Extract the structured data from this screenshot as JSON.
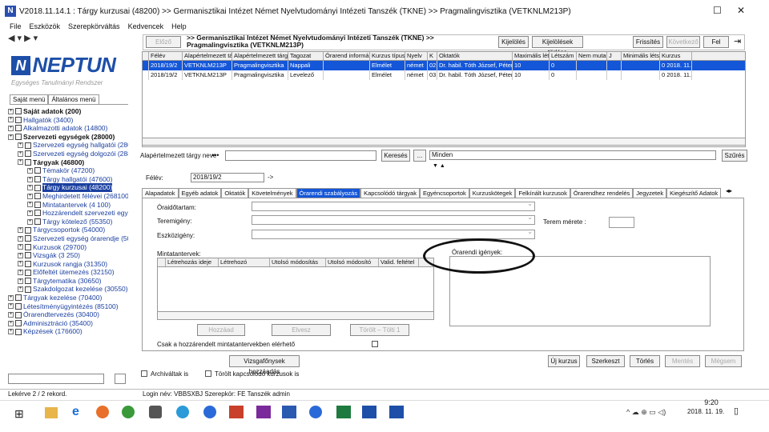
{
  "window": {
    "title": "V2018.11.14.1 : Tárgy kurzusai (48200) >> Germanisztikai Intézet Német Nyelvtudományi Intézeti Tanszék (TKNE) >> Pragmalingvisztika (VETKNLM213P)",
    "app_icon": "N"
  },
  "menu": [
    "File",
    "Eszközök",
    "Szerepkörváltás",
    "Kedvencek",
    "Help"
  ],
  "logo": {
    "brand": "NEPTUN",
    "subtitle": "Egységes Tanulmányi Rendszer"
  },
  "left_tabs": [
    "Saját menü",
    "Általános menü"
  ],
  "tree": [
    {
      "label": "Saját adatok (200)",
      "bold": true
    },
    {
      "label": "Hallgatók (3400)",
      "blue": true
    },
    {
      "label": "Alkalmazotti adatok (14800)",
      "blue": true
    },
    {
      "label": "Szervezeti egységek (28000)",
      "bold": true
    },
    {
      "label": "Szervezeti egység hallgatói (2800",
      "blue": true
    },
    {
      "label": "Szervezeti egység dolgozói (2880",
      "blue": true
    },
    {
      "label": "Tárgyak (46800)",
      "bold": true
    },
    {
      "label": "Témakör (47200)",
      "blue": true
    },
    {
      "label": "Tárgy hallgatói (47600)",
      "blue": true
    },
    {
      "label": "Tárgy kurzusai (48200)",
      "sel": true
    },
    {
      "label": "Meghirdetett félévei (268100)",
      "blue": true
    },
    {
      "label": "Mintatantervek (4 100)",
      "blue": true
    },
    {
      "label": "Hozzárendelt szervezeti egys",
      "blue": true
    },
    {
      "label": "Tárgy kötelező (55350)",
      "blue": true
    },
    {
      "label": "Tárgycsoportok (54000)",
      "blue": true
    },
    {
      "label": "Szervezeti egység órarendje (500",
      "blue": true
    },
    {
      "label": "Kurzusok (29700)",
      "blue": true
    },
    {
      "label": "Vizsgák (3 250)",
      "blue": true
    },
    {
      "label": "Kurzusok rangja (31350)",
      "blue": true
    },
    {
      "label": "Előfeltét ütemezés (32150)",
      "blue": true
    },
    {
      "label": "Tárgytematika (30650)",
      "blue": true
    },
    {
      "label": "Szakdolgozat kezelése (30550)",
      "blue": true
    },
    {
      "label": "Tárgyak kezelése (70400)",
      "blue": true
    },
    {
      "label": "Létesítményügyintézés (85100)",
      "blue": true
    },
    {
      "label": "Órarendtervezés (30400)",
      "blue": true
    },
    {
      "label": "Adminisztráció (35400)",
      "blue": true
    },
    {
      "label": "Képzések (176600)",
      "blue": true
    }
  ],
  "top": {
    "prev_button": "Előző",
    "breadcrumb": ">> Germanisztikai Intézet Német Nyelvtudományi Intézeti Tanszék (TKNE) >> Pragmalingvisztika (VETKNLM213P)",
    "buttons": [
      "Kijelölés",
      "Kijelölések törlése"
    ],
    "right_buttons": [
      "Frissítés",
      "Következő",
      "Fel"
    ]
  },
  "grid": {
    "columns": [
      "Félév",
      "Alapértelmezett tárgy",
      "Alapértelmezett tárgy neve",
      "Tagozat",
      "Órarend információ",
      "Kurzus típus",
      "Nyelv",
      "K",
      "Oktatók",
      "Maximális létszám",
      "Létszám",
      "Nem mutat",
      "J",
      "Minimális létszám",
      "Kurzus"
    ],
    "rows": [
      [
        "2018/19/2",
        "VETKNLM213P",
        "Pragmalingvisztika",
        "Nappali",
        "",
        "Elmélet",
        "német",
        "02",
        "Dr. habil. Tóth József, Péter",
        "10",
        "0",
        "",
        "",
        "",
        "0 2018. 11."
      ],
      [
        "2018/19/2",
        "VETKNLM213P",
        "Pragmalingvisztika",
        "Levelező",
        "",
        "Elmélet",
        "német",
        "03",
        "Dr. habil. Tóth József, Péter",
        "10",
        "0",
        "",
        "",
        "",
        "0 2018. 11."
      ]
    ]
  },
  "filter": {
    "label": "Alapértelmezett tárgy neve",
    "ops": "•••",
    "search_button": "Keresés",
    "dots_button": "...",
    "dropdown": "Minden",
    "apply_button": "Szűrés"
  },
  "semester": {
    "label": "Félév:",
    "value": "2018/19/2",
    "arrow": "->"
  },
  "tabs": [
    "Alapadatok",
    "Egyéb adatok",
    "Oktatók",
    "Követelmények",
    "Órarendi szabályozás",
    "Kapcsolódó tárgyak",
    "Egyéncsoportok",
    "Kurzuskötegek",
    "Felkínált kurzusok",
    "Órarendhez rendelés",
    "Jegyzetek",
    "Kiegészítő Adatok"
  ],
  "active_tab": "Órarendi szabályozás",
  "form": {
    "timeslot_label": "Óraidőtartam:",
    "room_type_label": "Teremigény:",
    "equipment_label": "Eszközigény:",
    "room_size_label": "Terem mérete :",
    "curricula_label": "Mintatantervek:",
    "requirements_label": "Órarendi igények:",
    "curricula_columns": [
      "Létrehozás ideje",
      "Létrehozó",
      "Utolsó módosítás",
      "Utolsó módosító",
      "Valid. feltétel"
    ],
    "buttons": [
      "Hozzáad",
      "Elvesz",
      "Törölt – Tölti 1"
    ],
    "only_checkbox": "Csak a hozzárendelt mintatantervekben elérhető",
    "special_button": "Vizsgafőnysek hozzáadás"
  },
  "bottom": {
    "archive_checkbox": "Archiváltak is",
    "deleted_checkbox": "Törölt kapcsolódó kurzusok is",
    "buttons": [
      "Új kurzus",
      "Szerkeszt",
      "Törlés",
      "Mentés",
      "Mégsem"
    ]
  },
  "status": {
    "records": "Lekérve 2 / 2 rekord.",
    "login": "Login név: VBBSXBJ   Szerepkör: FE Tanszék admin"
  },
  "taskbar": {
    "time": "9:20",
    "date": "2018. 11. 19."
  }
}
